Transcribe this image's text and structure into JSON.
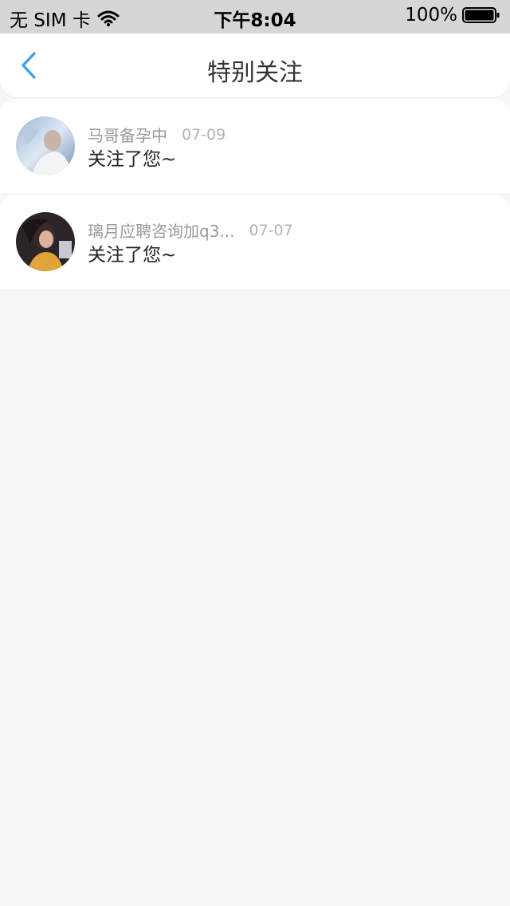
{
  "status_bar": {
    "carrier": "无 SIM 卡",
    "time": "下午8:04",
    "battery": "100%",
    "icons": [
      "wifi-icon",
      "battery-icon"
    ]
  },
  "nav": {
    "title": "特别关注",
    "back_icon": "chevron-left-icon",
    "accent_color": "#3a9ee8"
  },
  "items": [
    {
      "name": "马哥备孕中",
      "date": "07-09",
      "message": "关注了您~",
      "avatar": "avatar-photo"
    },
    {
      "name": "璃月应聘咨询加q3...",
      "date": "07-07",
      "message": "关注了您~",
      "avatar": "avatar-photo"
    }
  ]
}
